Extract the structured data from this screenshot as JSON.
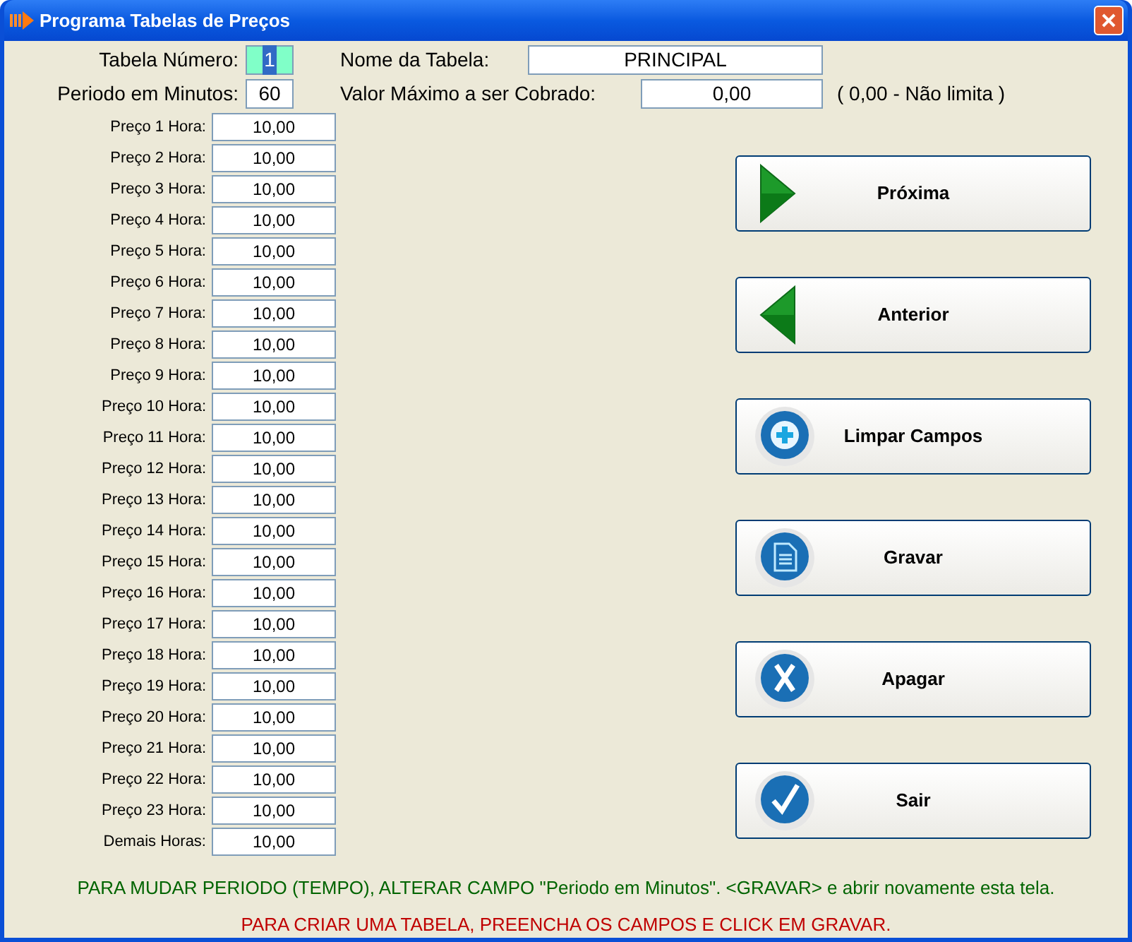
{
  "window": {
    "title": "Programa Tabelas de Preços"
  },
  "header": {
    "table_number": {
      "label": "Tabela Número:",
      "value": "1",
      "text_selected": true
    },
    "table_name": {
      "label": "Nome da Tabela:",
      "value": "PRINCIPAL"
    },
    "period": {
      "label": "Periodo em Minutos:",
      "value": "60"
    },
    "max_value": {
      "label": "Valor Máximo a ser Cobrado:",
      "value": "0,00",
      "note": "( 0,00 - Não limita )"
    }
  },
  "prices": [
    {
      "label": "Preço 1 Hora:",
      "value": "10,00"
    },
    {
      "label": "Preço 2 Hora:",
      "value": "10,00"
    },
    {
      "label": "Preço 3 Hora:",
      "value": "10,00"
    },
    {
      "label": "Preço 4 Hora:",
      "value": "10,00"
    },
    {
      "label": "Preço 5 Hora:",
      "value": "10,00"
    },
    {
      "label": "Preço 6 Hora:",
      "value": "10,00"
    },
    {
      "label": "Preço 7 Hora:",
      "value": "10,00"
    },
    {
      "label": "Preço 8 Hora:",
      "value": "10,00"
    },
    {
      "label": "Preço 9 Hora:",
      "value": "10,00"
    },
    {
      "label": "Preço 10 Hora:",
      "value": "10,00"
    },
    {
      "label": "Preço 11 Hora:",
      "value": "10,00"
    },
    {
      "label": "Preço 12 Hora:",
      "value": "10,00"
    },
    {
      "label": "Preço 13 Hora:",
      "value": "10,00"
    },
    {
      "label": "Preço 14 Hora:",
      "value": "10,00"
    },
    {
      "label": "Preço 15 Hora:",
      "value": "10,00"
    },
    {
      "label": "Preço 16 Hora:",
      "value": "10,00"
    },
    {
      "label": "Preço 17 Hora:",
      "value": "10,00"
    },
    {
      "label": "Preço 18 Hora:",
      "value": "10,00"
    },
    {
      "label": "Preço 19 Hora:",
      "value": "10,00"
    },
    {
      "label": "Preço 20 Hora:",
      "value": "10,00"
    },
    {
      "label": "Preço 21 Hora:",
      "value": "10,00"
    },
    {
      "label": "Preço 22 Hora:",
      "value": "10,00"
    },
    {
      "label": "Preço 23 Hora:",
      "value": "10,00"
    },
    {
      "label": "Demais Horas:",
      "value": "10,00"
    }
  ],
  "buttons": [
    {
      "label": "Próxima",
      "kind": "next"
    },
    {
      "label": "Anterior",
      "kind": "previous"
    },
    {
      "label": "Limpar Campos",
      "kind": "add"
    },
    {
      "label": "Gravar",
      "kind": "save"
    },
    {
      "label": "Apagar",
      "kind": "delete"
    },
    {
      "label": "Sair",
      "kind": "exit"
    }
  ],
  "footer": [
    {
      "text": "PARA MUDAR PERIODO (TEMPO), ALTERAR CAMPO \"Periodo em Minutos\". <GRAVAR> e abrir novamente esta tela.",
      "color": "#006400"
    },
    {
      "text": "PARA CRIAR UMA TABELA, PREENCHA OS CAMPOS E CLICK EM GRAVAR.",
      "color": "#c00000"
    }
  ]
}
